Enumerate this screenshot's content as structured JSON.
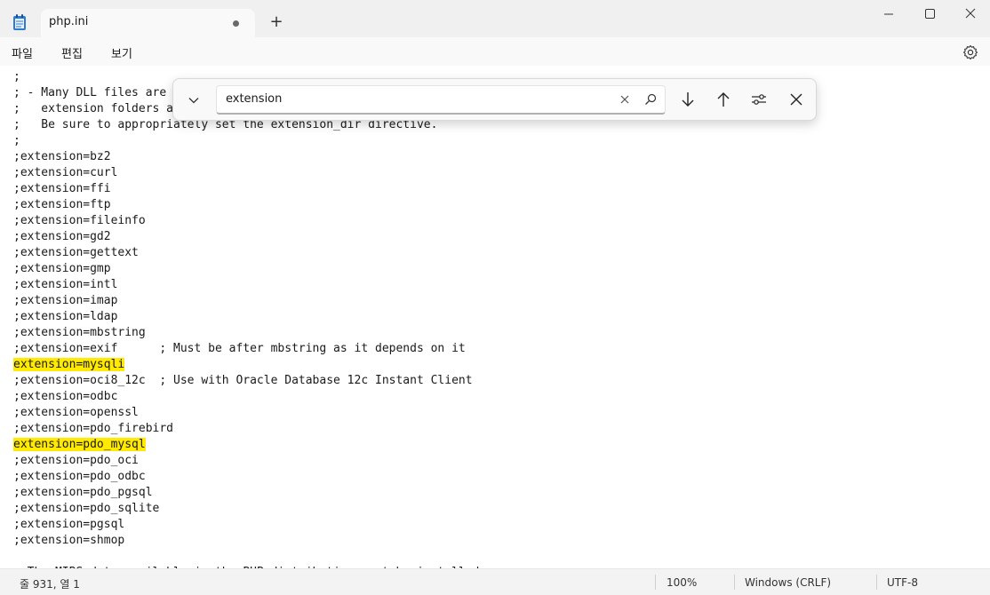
{
  "window": {
    "tab_title": "php.ini",
    "new_tab_label": "+"
  },
  "menu": {
    "file": "파일",
    "edit": "편집",
    "view": "보기"
  },
  "find": {
    "query": "extension"
  },
  "editor": {
    "lines": [
      ";",
      "; - Many DLL files are",
      ";   extension folders a",
      ";   Be sure to appropriately set the extension_dir directive.",
      ";",
      ";extension=bz2",
      ";extension=curl",
      ";extension=ffi",
      ";extension=ftp",
      ";extension=fileinfo",
      ";extension=gd2",
      ";extension=gettext",
      ";extension=gmp",
      ";extension=intl",
      ";extension=imap",
      ";extension=ldap",
      ";extension=mbstring",
      ";extension=exif      ; Must be after mbstring as it depends on it",
      "extension=mysqli",
      ";extension=oci8_12c  ; Use with Oracle Database 12c Instant Client",
      ";extension=odbc",
      ";extension=openssl",
      ";extension=pdo_firebird",
      "extension=pdo_mysql",
      ";extension=pdo_oci",
      ";extension=pdo_odbc",
      ";extension=pdo_pgsql",
      ";extension=pdo_sqlite",
      ";extension=pgsql",
      ";extension=shmop",
      "",
      "; The MIBS data available in the PHP distribution must be installed."
    ],
    "highlighted_lines": [
      18,
      23
    ],
    "highlight_color": "#ffea00"
  },
  "status": {
    "position": "줄 931, 열 1",
    "zoom": "100%",
    "line_ending": "Windows (CRLF)",
    "encoding": "UTF-8"
  }
}
